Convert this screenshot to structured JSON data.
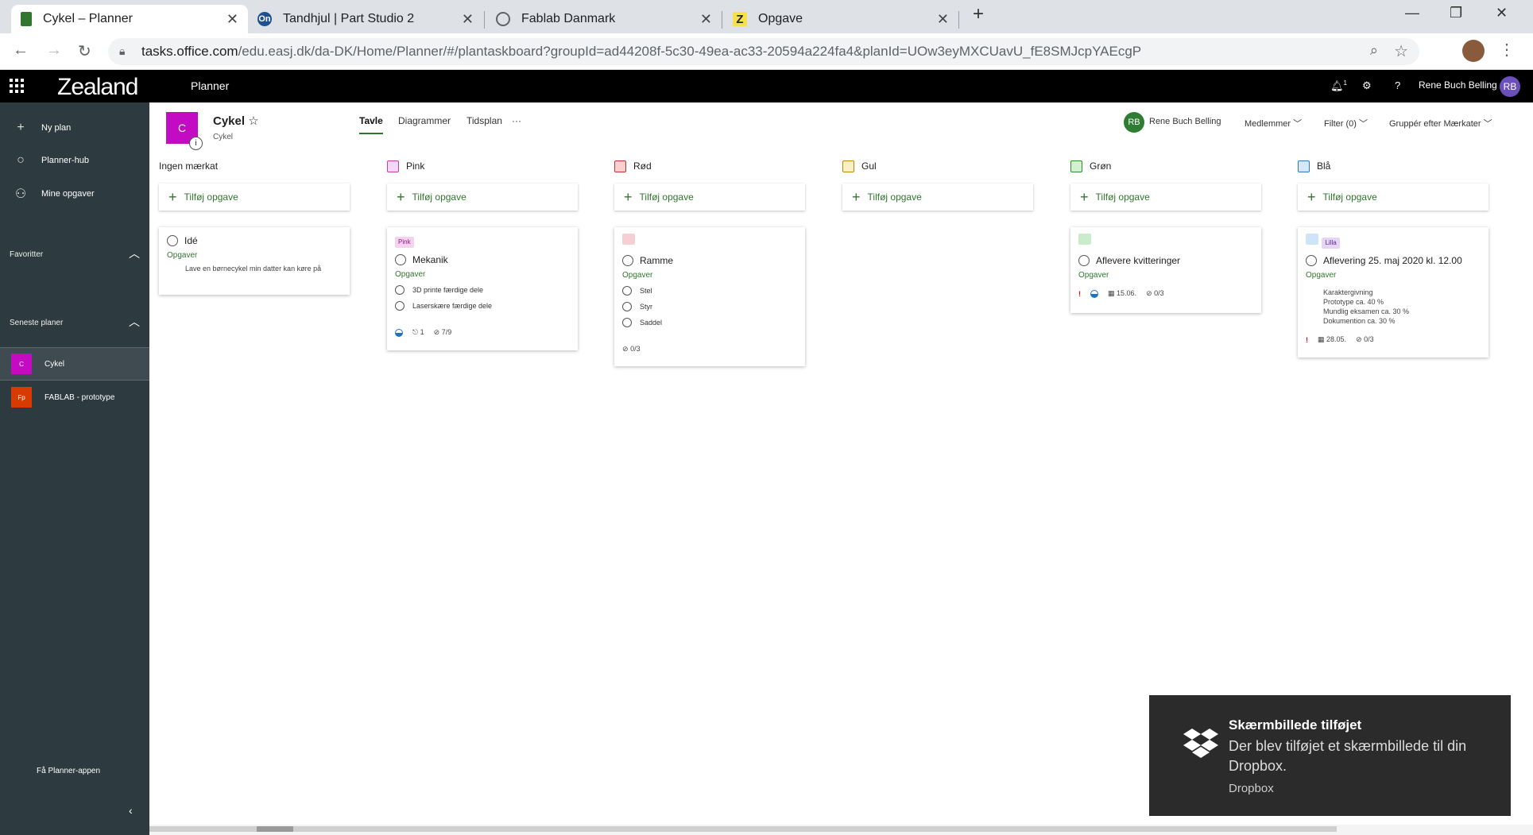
{
  "browser": {
    "tabs": [
      {
        "title": "Cykel – Planner",
        "icon": "planner-icon"
      },
      {
        "title": "Tandhjul | Part Studio 2",
        "icon": "onshape-icon",
        "icon_text": "On"
      },
      {
        "title": "Fablab Danmark",
        "icon": "globe-icon"
      },
      {
        "title": "Opgave",
        "icon": "z-icon",
        "icon_text": "Z"
      }
    ],
    "url_host": "tasks.office.com",
    "url_path": "/edu.easj.dk/da-DK/Home/Planner/#/plantaskboard?groupId=ad44208f-5c30-49ea-ac33-20594a224fa4&planId=UOw3eyMXCUavU_fE8SMJcpYAEcgP"
  },
  "suite": {
    "brand": "Zealand",
    "app": "Planner",
    "notification_count": "1",
    "user": "Rene Buch Belling",
    "user_initials": "RB"
  },
  "nav": {
    "items": [
      "Ny plan",
      "Planner-hub",
      "Mine opgaver"
    ],
    "favorites_label": "Favoritter",
    "recent_label": "Seneste planer",
    "recent_plans": [
      {
        "icon": "C",
        "name": "Cykel",
        "color": "#c40bc4"
      },
      {
        "icon": "Fp",
        "name": "FABLAB - prototype",
        "color": "#d83b01"
      }
    ],
    "get_app": "Få Planner-appen"
  },
  "plan": {
    "logo_letter": "C",
    "title": "Cykel",
    "subtitle": "Cykel",
    "views": [
      "Tavle",
      "Diagrammer",
      "Tidsplan"
    ],
    "more": "···",
    "owner_initials": "RB",
    "owner_name": "Rene Buch Belling",
    "members": "Medlemmer",
    "filter": "Filter (0)",
    "group_by": "Gruppér efter Mærkater"
  },
  "board": {
    "add_task": "Tilføj opgave",
    "bucket_name": "Opgaver",
    "columns": [
      {
        "name": "Ingen mærkat",
        "swatch": "",
        "border": ""
      },
      {
        "name": "Pink",
        "swatch": "#f8d7f4",
        "border": "#c13fa9"
      },
      {
        "name": "Rød",
        "swatch": "#f8d0d0",
        "border": "#c53030"
      },
      {
        "name": "Gul",
        "swatch": "#fbefc9",
        "border": "#b88a00"
      },
      {
        "name": "Grøn",
        "swatch": "#d3f0d3",
        "border": "#2e8b2e"
      },
      {
        "name": "Blå",
        "swatch": "#d6e8f8",
        "border": "#2b79c2"
      }
    ],
    "cards": {
      "ide": {
        "title": "Idé",
        "desc": "Lave en børnecykel min datter kan køre på"
      },
      "mekanik": {
        "label": "Pink",
        "title": "Mekanik",
        "checklist": [
          "3D printe færdige dele",
          "Laserskære færdige dele"
        ],
        "attachments": "1",
        "checklist_count": "7/9"
      },
      "ramme": {
        "title": "Ramme",
        "checklist": [
          "Stel",
          "Styr",
          "Saddel"
        ],
        "checklist_count": "0/3"
      },
      "kvitteringer": {
        "title": "Aflevere kvitteringer",
        "urgent": "!",
        "due": "15.06.",
        "checklist_count": "0/3"
      },
      "aflevering": {
        "label": "Lilla",
        "title": "Aflevering 25. maj 2020 kl. 12.00",
        "desc_lines": [
          "Karaktergivning",
          "Prototype ca. 40 %",
          "Mundlig eksamen ca. 30 %",
          "Dokumention ca. 30 %"
        ],
        "urgent": "!",
        "due": "28.05.",
        "checklist_count": "0/3"
      }
    }
  },
  "toast": {
    "title": "Skærmbillede tilføjet",
    "body": "Der blev tilføjet et skærmbillede til din Dropbox.",
    "source": "Dropbox"
  }
}
